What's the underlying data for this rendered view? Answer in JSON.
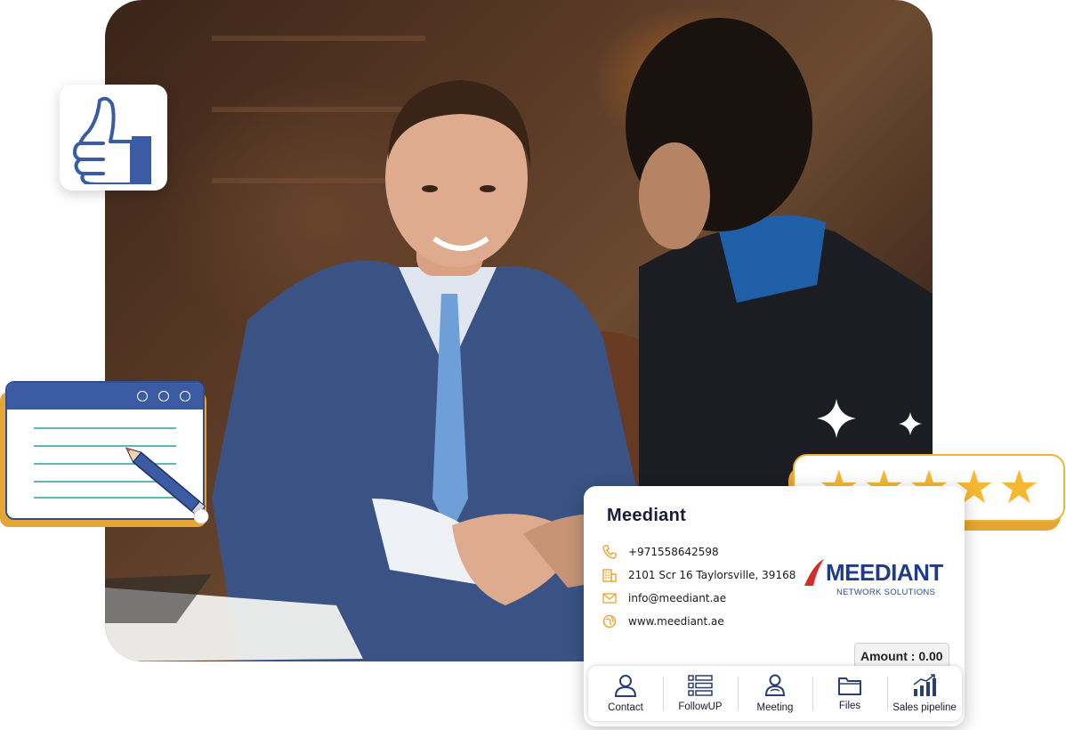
{
  "contact_card": {
    "name": "Meediant",
    "phone": "+971558642598",
    "address": "2101 Scr 16 Taylorsville, 39168",
    "email": "info@meediant.ae",
    "website": "www.meediant.ae",
    "amount": "Amount : 0.00"
  },
  "logo": {
    "title": "MEEDIANT",
    "subtitle": "NETWORK SOLUTIONS"
  },
  "tabs": [
    {
      "label": "Contact",
      "icon": "person-icon"
    },
    {
      "label": "FollowUP",
      "icon": "list-icon"
    },
    {
      "label": "Meeting",
      "icon": "people-icon"
    },
    {
      "label": "Files",
      "icon": "folder-icon"
    },
    {
      "label": "Sales pipeline",
      "icon": "chart-icon"
    }
  ],
  "rating": {
    "stars": 5,
    "max": 5
  },
  "colors": {
    "accent_gold": "#e5a633",
    "star": "#f7b731",
    "brand_blue": "#3b5ba5"
  }
}
